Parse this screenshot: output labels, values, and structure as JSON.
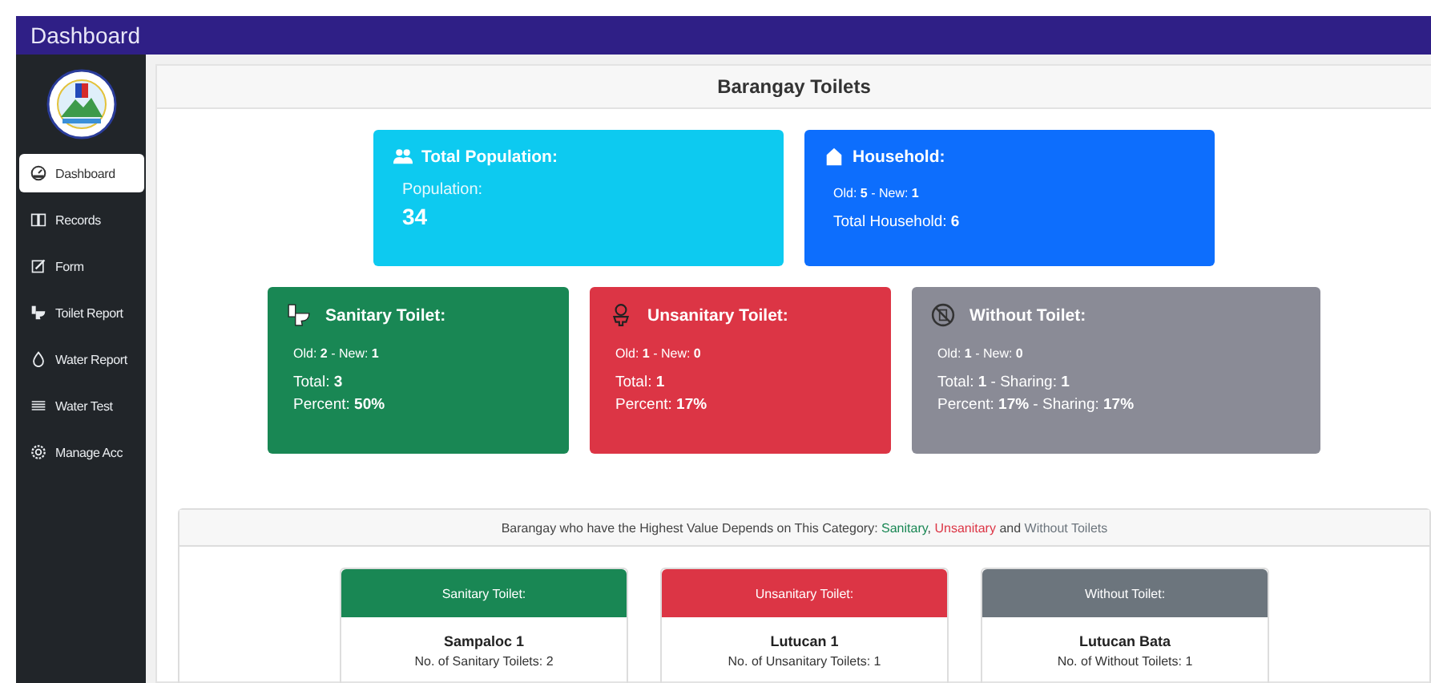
{
  "header": {
    "title": "Dashboard"
  },
  "sidebar": {
    "items": [
      {
        "label": "Dashboard",
        "selected": true
      },
      {
        "label": "Records",
        "selected": false
      },
      {
        "label": "Form",
        "selected": false
      },
      {
        "label": "Toilet Report",
        "selected": false
      },
      {
        "label": "Water Report",
        "selected": false
      },
      {
        "label": "Water Test",
        "selected": false
      },
      {
        "label": "Manage Acc",
        "selected": false
      }
    ]
  },
  "panel": {
    "title": "Barangay Toilets"
  },
  "stat_rows": [
    [
      {
        "title": "Total Population:",
        "color": "#0dcaf0",
        "lines": [
          {
            "kind": "label",
            "text": "Population:"
          },
          {
            "kind": "big",
            "text": "34"
          }
        ]
      },
      {
        "title": "Household:",
        "color": "#0d6efd",
        "lines": [
          {
            "kind": "small",
            "text": "Old: **5** - New: **1**"
          },
          {
            "kind": "normal",
            "text": "Total Household: **6**"
          }
        ]
      }
    ],
    [
      {
        "title": "Sanitary Toilet:",
        "color": "#198754",
        "lines": [
          {
            "kind": "small",
            "text": "Old: **2** - New: **1**"
          },
          {
            "kind": "normal",
            "text": "Total: **3**"
          },
          {
            "kind": "normal",
            "text": "Percent: **50%**"
          }
        ]
      },
      {
        "title": "Unsanitary Toilet:",
        "color": "#dc3545",
        "lines": [
          {
            "kind": "small",
            "text": "Old: **1** - New: **0**"
          },
          {
            "kind": "normal",
            "text": "Total: **1**"
          },
          {
            "kind": "normal",
            "text": "Percent: **17%**"
          }
        ]
      },
      {
        "title": "Without Toilet:",
        "color": "#8a8b96",
        "lines": [
          {
            "kind": "small",
            "text": "Old: **1** - New: **0**"
          },
          {
            "kind": "normal",
            "text": "Total: **1** - Sharing: **1**"
          },
          {
            "kind": "normal",
            "text": "Percent: **17%** - Sharing: **17%**"
          }
        ]
      }
    ]
  ],
  "highest": {
    "caption": "Barangay who have the Highest Value Depends on This Category:",
    "categories": [
      {
        "text": "Sanitary",
        "color": "#198754",
        "after": ","
      },
      {
        "text": "Unsanitary",
        "color": "#dc3545",
        "after": "and"
      },
      {
        "text": "Without Toilets",
        "color": "#6c757d"
      }
    ],
    "cards": [
      {
        "title": "Sanitary Toilet:",
        "color": "#198754",
        "name": "Sampaloc 1",
        "count": "No. of Sanitary Toilets: 2"
      },
      {
        "title": "Unsanitary Toilet:",
        "color": "#dc3545",
        "name": "Lutucan 1",
        "count": "No. of Unsanitary Toilets: 1"
      },
      {
        "title": "Without Toilet:",
        "color": "#6c757d",
        "name": "Lutucan Bata",
        "count": "No. of Without Toilets: 1"
      }
    ]
  }
}
